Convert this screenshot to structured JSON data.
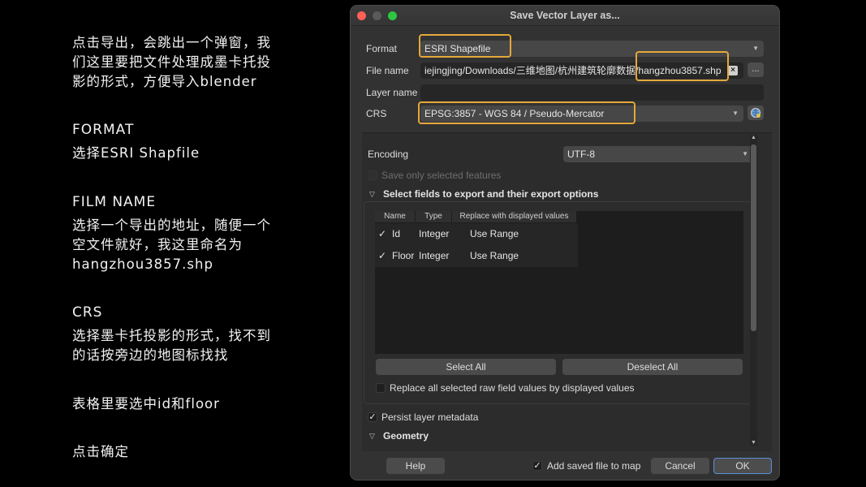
{
  "notes": {
    "intro": "点击导出，会跳出一个弹窗，我\n们这里要把文件处理成墨卡托投\n影的形式，方便导入blender",
    "format_heading": "FORMAT",
    "format_text": "选择ESRI Shapfile",
    "filmname_heading": "FILM NAME",
    "filmname_text": "选择一个导出的地址，随便一个\n空文件就好，我这里命名为\nhangzhou3857.shp",
    "crs_heading": "CRS",
    "crs_text": "选择墨卡托投影的形式，找不到\n的话按旁边的地图标找找",
    "table_text": "表格里要选中id和floor",
    "confirm_text": "点击确定"
  },
  "dialog": {
    "title": "Save Vector Layer as...",
    "format_label": "Format",
    "format_value": "ESRI Shapefile",
    "filename_label": "File name",
    "filename_value": "iejingjing/Downloads/三维地图/杭州建筑轮廓数据/hangzhou3857.shp",
    "browse_label": "...",
    "layername_label": "Layer name",
    "layername_value": "",
    "crs_label": "CRS",
    "crs_value": "EPSG:3857 - WGS 84 / Pseudo-Mercator",
    "encoding_label": "Encoding",
    "encoding_value": "UTF-8",
    "save_selected_label": "Save only selected features",
    "fields_section_title": "Select fields to export and their export options",
    "table_headers": [
      "Name",
      "Type",
      "Replace with displayed values"
    ],
    "rows": [
      {
        "check": "✓",
        "name": "Id",
        "type": "Integer",
        "replace": "Use Range"
      },
      {
        "check": "✓",
        "name": "Floor",
        "type": "Integer",
        "replace": "Use Range"
      }
    ],
    "select_all_label": "Select All",
    "deselect_all_label": "Deselect All",
    "replace_all_label": "Replace all selected raw field values by displayed values",
    "persist_label": "Persist layer metadata",
    "persist_check": "✓",
    "geometry_title": "Geometry",
    "help_label": "Help",
    "add_saved_label": "Add saved file to map",
    "add_saved_check": "✓",
    "cancel_label": "Cancel",
    "ok_label": "OK"
  },
  "colors": {
    "highlight": "#e3a839",
    "dialog_bg": "#323232"
  }
}
